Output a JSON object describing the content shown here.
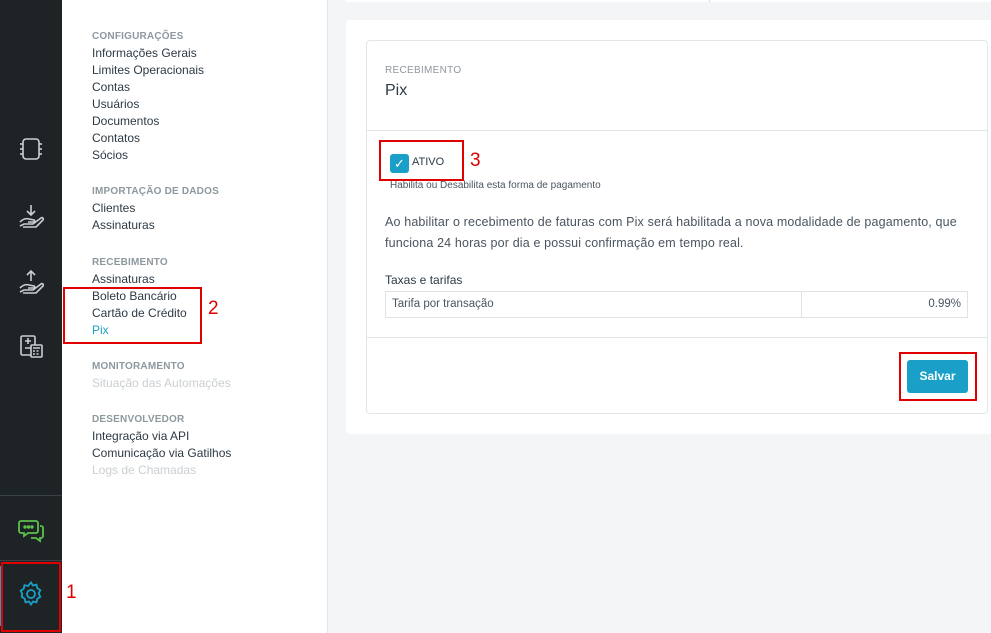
{
  "rail": {
    "items": [
      {
        "icon": "document-chip-icon"
      },
      {
        "icon": "receive-money-icon"
      },
      {
        "icon": "send-money-icon"
      },
      {
        "icon": "invoice-calculator-icon"
      },
      {
        "icon": "chat-support-icon",
        "color": "#5cc24a"
      },
      {
        "icon": "gear-icon",
        "color": "#1aa0c8",
        "active": true
      }
    ]
  },
  "menu": {
    "groups": [
      {
        "heading": "CONFIGURAÇÕES",
        "items": [
          {
            "label": "Informações Gerais"
          },
          {
            "label": "Limites Operacionais"
          },
          {
            "label": "Contas"
          },
          {
            "label": "Usuários"
          },
          {
            "label": "Documentos"
          },
          {
            "label": "Contatos"
          },
          {
            "label": "Sócios"
          }
        ]
      },
      {
        "heading": "IMPORTAÇÃO DE DADOS",
        "items": [
          {
            "label": "Clientes"
          },
          {
            "label": "Assinaturas"
          }
        ]
      },
      {
        "heading": "RECEBIMENTO",
        "items": [
          {
            "label": "Assinaturas"
          },
          {
            "label": "Boleto Bancário"
          },
          {
            "label": "Cartão de Crédito"
          },
          {
            "label": "Pix",
            "active": true
          }
        ]
      },
      {
        "heading": "MONITORAMENTO",
        "items": [
          {
            "label": "Situação das Automações",
            "disabled": true
          }
        ]
      },
      {
        "heading": "DESENVOLVEDOR",
        "items": [
          {
            "label": "Integração via API"
          },
          {
            "label": "Comunicação via Gatilhos"
          },
          {
            "label": "Logs de Chamadas",
            "disabled": true
          }
        ]
      }
    ]
  },
  "panel": {
    "eyebrow": "RECEBIMENTO",
    "title": "Pix",
    "checkbox": {
      "checked": true,
      "mark": "✓",
      "label": "ATIVO",
      "help": "Habilita ou Desabilita esta forma de pagamento"
    },
    "description": "Ao habilitar o recebimento de faturas com Pix será habilitada a nova modalidade de pagamento, que funciona 24 horas por dia e possui confirmação em tempo real.",
    "fees": {
      "title": "Taxas e tarifas",
      "rows": [
        {
          "label": "Tarifa por transação",
          "value": "0.99%"
        }
      ]
    },
    "save_label": "Salvar"
  },
  "annotations": {
    "one": "1",
    "two": "2",
    "three": "3",
    "color": "#e00000"
  },
  "colors": {
    "accent": "#1aa0c8",
    "rail_bg": "#1e2326",
    "page_bg": "#f4f5f7"
  }
}
